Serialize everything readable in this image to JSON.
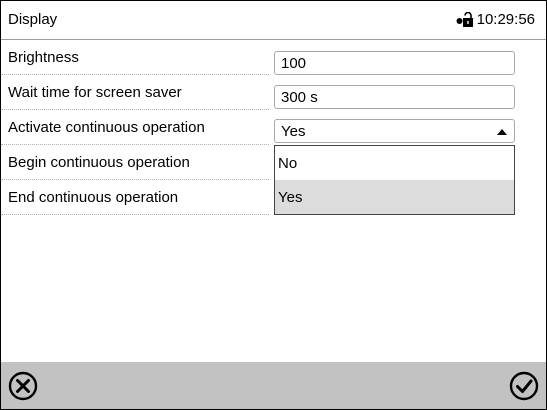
{
  "header": {
    "title": "Display",
    "time": "10:29:56",
    "lock_icon": "user-unlock-icon"
  },
  "settings": [
    {
      "label": "Brightness",
      "value": "100"
    },
    {
      "label": "Wait time for screen saver",
      "value": "300 s"
    },
    {
      "label": "Activate continuous operation",
      "value": "Yes"
    },
    {
      "label": "Begin continuous operation"
    },
    {
      "label": "End continuous operation"
    }
  ],
  "dropdown": {
    "options": [
      "No",
      "Yes"
    ],
    "selected": "Yes"
  },
  "footer": {
    "cancel_icon": "cancel-icon",
    "confirm_icon": "confirm-icon"
  }
}
